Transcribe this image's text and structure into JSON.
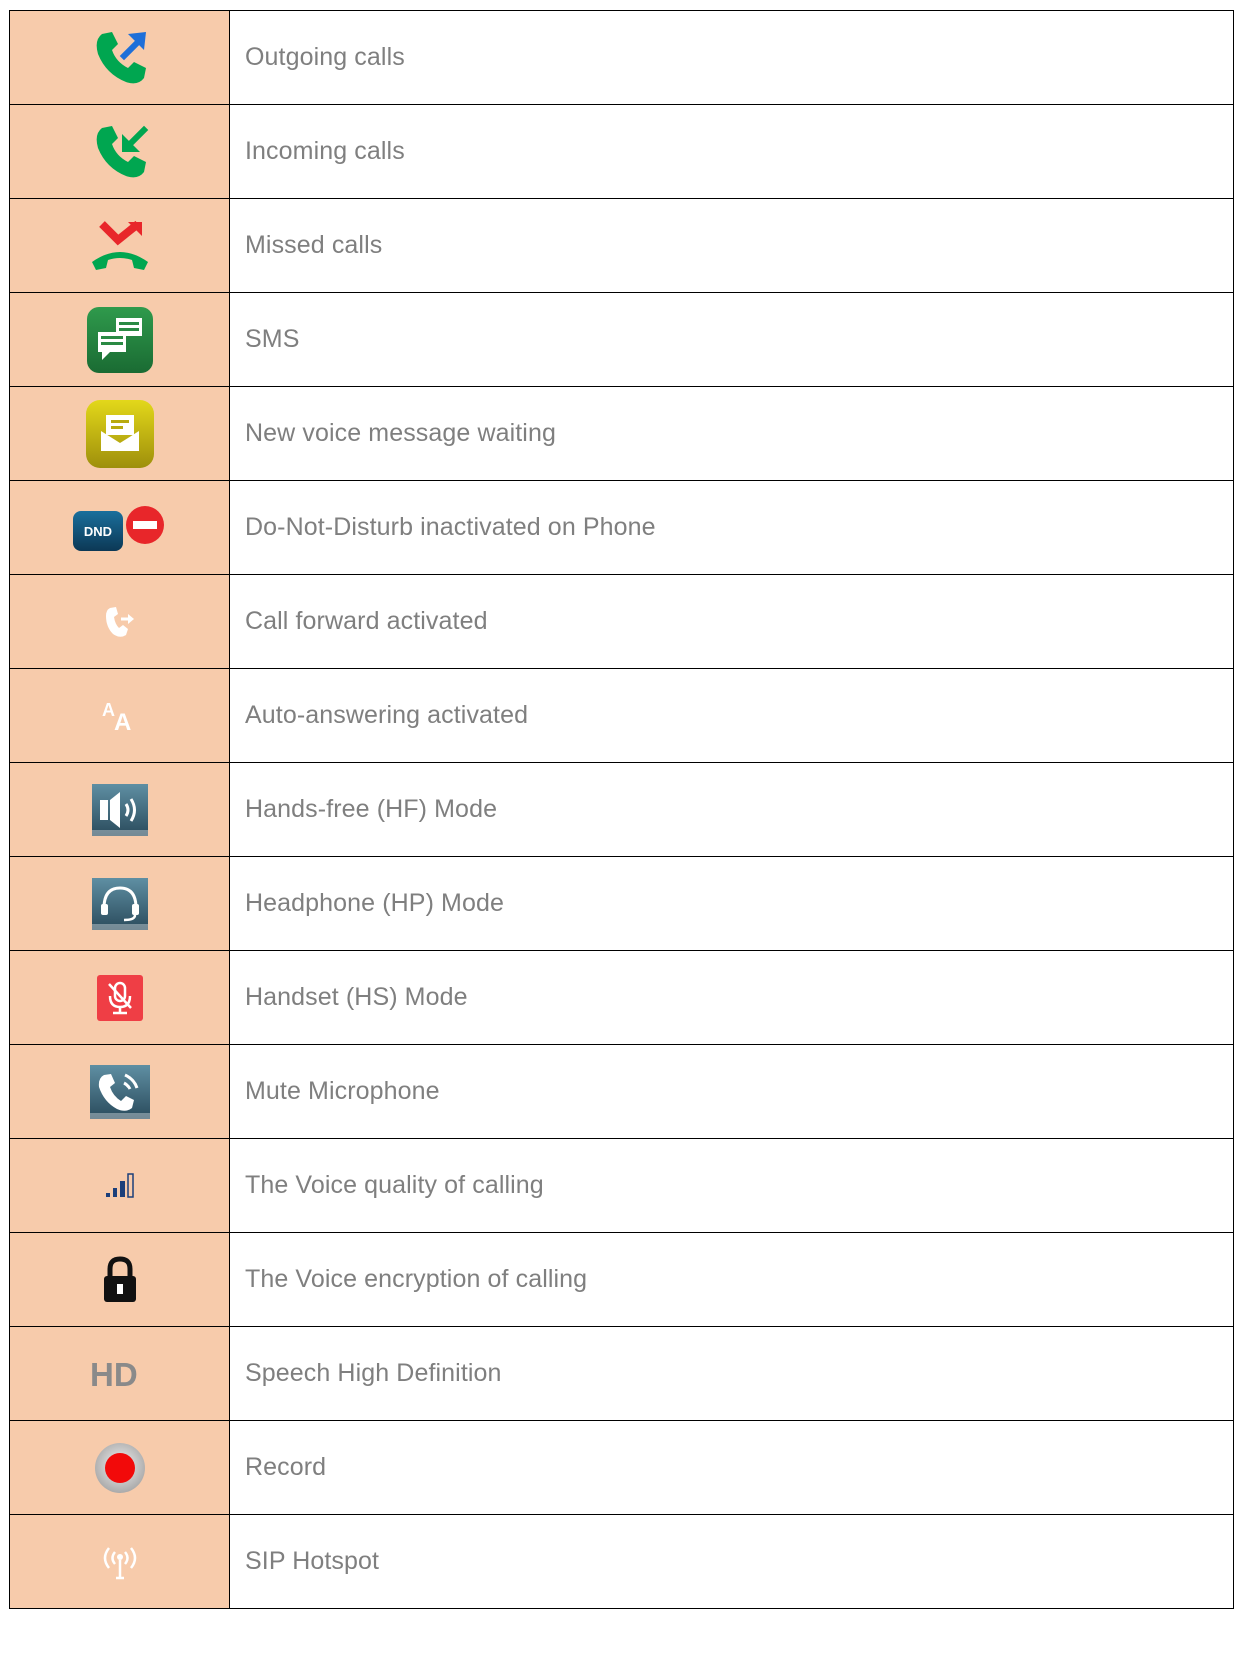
{
  "colors": {
    "icon_column_bg": "#f7cbab",
    "border": "#000000",
    "text": "#7f7f7f"
  },
  "rows": [
    {
      "icon": "outgoing-call-icon",
      "label": "Outgoing calls"
    },
    {
      "icon": "incoming-call-icon",
      "label": "Incoming calls"
    },
    {
      "icon": "missed-call-icon",
      "label": "Missed calls"
    },
    {
      "icon": "sms-icon",
      "label": "SMS"
    },
    {
      "icon": "voicemail-icon",
      "label": "New voice message waiting"
    },
    {
      "icon": "dnd-icon",
      "label": "Do-Not-Disturb inactivated on Phone"
    },
    {
      "icon": "call-forward-icon",
      "label": "Call forward activated"
    },
    {
      "icon": "auto-answer-icon",
      "label": "Auto-answering activated"
    },
    {
      "icon": "speaker-icon",
      "label": "Hands-free (HF) Mode"
    },
    {
      "icon": "headset-icon",
      "label": "Headphone (HP) Mode"
    },
    {
      "icon": "microphone-muted-icon",
      "label": "Handset (HS) Mode"
    },
    {
      "icon": "handset-call-icon",
      "label": "Mute Microphone"
    },
    {
      "icon": "signal-quality-icon",
      "label": "The Voice quality of calling"
    },
    {
      "icon": "lock-icon",
      "label": "The Voice encryption of calling"
    },
    {
      "icon": "hd-icon",
      "label": "Speech High Definition"
    },
    {
      "icon": "record-icon",
      "label": "Record"
    },
    {
      "icon": "hotspot-icon",
      "label": "SIP Hotspot"
    }
  ]
}
